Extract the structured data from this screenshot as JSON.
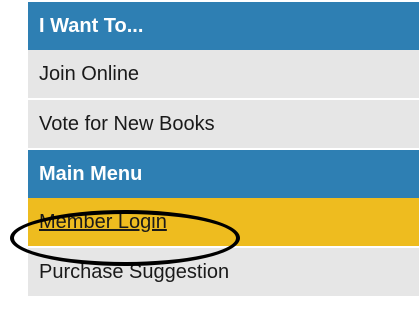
{
  "menu": {
    "sections": [
      {
        "header": "I Want To...",
        "items": [
          {
            "label": "Join Online"
          },
          {
            "label": "Vote for New Books"
          }
        ]
      },
      {
        "header": "Main Menu",
        "items": [
          {
            "label": "Member Login",
            "active": true
          },
          {
            "label": "Purchase Suggestion"
          }
        ]
      }
    ]
  },
  "colors": {
    "header_bg": "#2e7fb3",
    "item_bg": "#e6e6e6",
    "active_bg": "#eebc1f",
    "annotation_circle": "#000000"
  }
}
